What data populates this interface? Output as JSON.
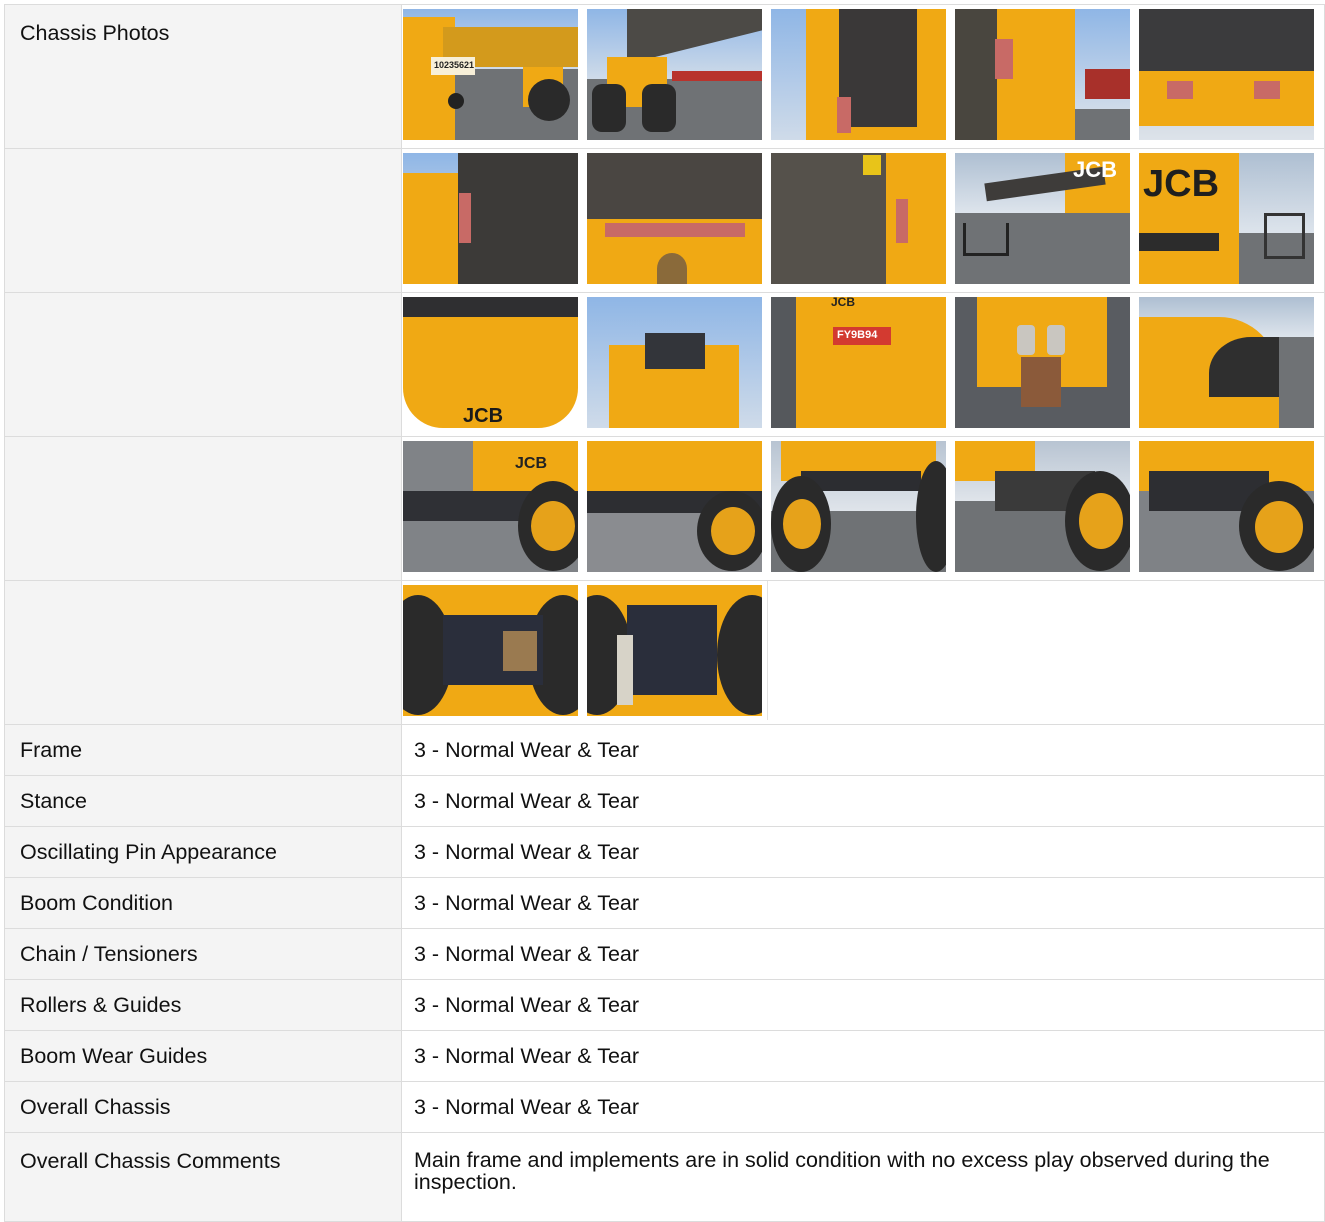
{
  "section": {
    "photos_label": "Chassis Photos",
    "photo_count": 22
  },
  "ratings": [
    {
      "label": "Frame",
      "value": "3 - Normal Wear & Tear"
    },
    {
      "label": "Stance",
      "value": "3 - Normal Wear & Tear"
    },
    {
      "label": "Oscillating Pin Appearance",
      "value": "3 - Normal Wear & Tear"
    },
    {
      "label": "Boom Condition",
      "value": "3 - Normal Wear & Tear"
    },
    {
      "label": "Chain / Tensioners",
      "value": "3 - Normal Wear & Tear"
    },
    {
      "label": "Rollers & Guides",
      "value": "3 - Normal Wear & Tear"
    },
    {
      "label": "Boom Wear Guides",
      "value": "3 - Normal Wear & Tear"
    },
    {
      "label": "Overall Chassis",
      "value": "3 - Normal Wear & Tear"
    }
  ],
  "comments": {
    "label": "Overall Chassis Comments",
    "value": "Main frame and implements are in solid condition with no excess play observed during the inspection."
  },
  "photo_text": {
    "serial_plate": "10235621",
    "jcb_logo": "JCB",
    "reg_plate": "FY9B94"
  },
  "colors": {
    "machine_yellow": "#f0a914",
    "label_bg": "#f4f4f4",
    "border": "#dcdcdc"
  }
}
